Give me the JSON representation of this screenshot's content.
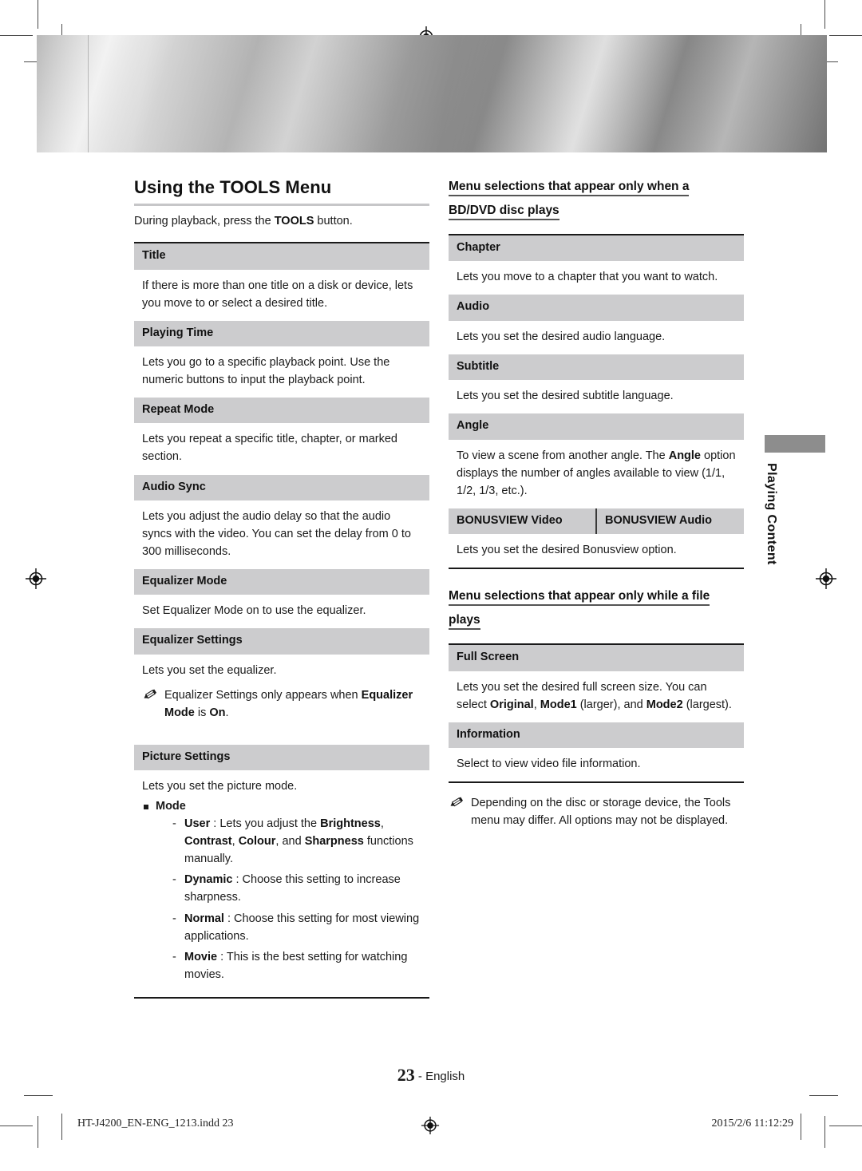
{
  "document": {
    "page_number": "23",
    "page_language": "- English",
    "side_tab_label": "Playing Content",
    "footer_file": "HT-J4200_EN-ENG_1213.indd   23",
    "footer_timestamp": "2015/2/6   11:12:29"
  },
  "left_column": {
    "title": "Using the TOOLS Menu",
    "intro_before": "During playback, press the ",
    "intro_bold": "TOOLS",
    "intro_after": " button.",
    "rows": [
      {
        "head": "Title",
        "body": "If there is more than one title on a disk or device, lets you move to or select a desired title."
      },
      {
        "head": "Playing Time",
        "body": "Lets you go to a specific playback point. Use the numeric buttons to input the playback point."
      },
      {
        "head": "Repeat Mode",
        "body": "Lets you repeat a specific title, chapter, or marked section."
      },
      {
        "head": "Audio Sync",
        "body": "Lets you adjust the audio delay so that the audio syncs with the video. You can set the delay from 0 to 300 milliseconds."
      },
      {
        "head": "Equalizer Mode",
        "body": "Set Equalizer Mode on to use the equalizer."
      },
      {
        "head": "Equalizer Settings",
        "body": "Lets you set the equalizer."
      }
    ],
    "equalizer_note": {
      "text_1": "Equalizer Settings only appears when ",
      "bold_1": "Equalizer Mode",
      "text_2": " is ",
      "bold_2": "On",
      "text_3": "."
    },
    "picture_settings": {
      "head": "Picture Settings",
      "body": "Lets you set the picture mode.",
      "bullet": "Mode",
      "modes": [
        {
          "name": "User",
          "text_1": " : Lets you adjust the ",
          "bold_1": "Brightness",
          "text_2": ", ",
          "bold_2": "Contrast",
          "text_3": ", ",
          "bold_3": "Colour",
          "text_4": ", and ",
          "bold_4": "Sharpness",
          "text_5": " functions manually."
        },
        {
          "name": "Dynamic",
          "text_1": " : Choose this setting to increase sharpness."
        },
        {
          "name": "Normal",
          "text_1": " : Choose this setting for most viewing applications."
        },
        {
          "name": "Movie",
          "text_1": " : This is the best setting for watching movies."
        }
      ]
    }
  },
  "right_column": {
    "subtitle_bd_line1": "Menu selections that appear only when a",
    "subtitle_bd_line2": "BD/DVD disc plays",
    "bd_rows": [
      {
        "head": "Chapter",
        "body": "Lets you move to a chapter that you want to watch."
      },
      {
        "head": "Audio",
        "body": "Lets you set the desired audio language."
      },
      {
        "head": "Subtitle",
        "body": "Lets you set the desired subtitle language."
      }
    ],
    "angle": {
      "head": "Angle",
      "text_1": "To view a scene from another angle. The ",
      "bold_1": "Angle",
      "text_2": " option displays the number of angles available to view (1/1, 1/2, 1/3, etc.)."
    },
    "bonusview": {
      "head_video": "BONUSVIEW Video",
      "head_audio": "BONUSVIEW Audio",
      "body": "Lets you set the desired Bonusview option."
    },
    "subtitle_file_line1": "Menu selections that appear only while a file",
    "subtitle_file_line2": "plays",
    "full_screen": {
      "head": "Full Screen",
      "text_1": "Lets you set the desired full screen size. You can select ",
      "bold_1": "Original",
      "text_2": ", ",
      "bold_2": "Mode1",
      "text_3": " (larger), and ",
      "bold_3": "Mode2",
      "text_4": " (largest)."
    },
    "information": {
      "head": "Information",
      "body": "Select to view video file information."
    },
    "footer_note": "Depending on the disc or storage device, the Tools menu may differ. All options may not be displayed."
  }
}
